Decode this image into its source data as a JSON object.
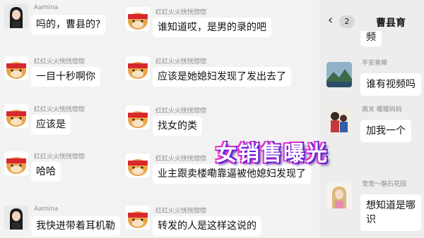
{
  "left_column": {
    "messages": [
      {
        "sender": "Aamina",
        "text": "吗的，曹县的?",
        "avatar": "woman-portrait-avatar"
      },
      {
        "sender": "红红火火恍恍惚惚",
        "text": "一目十秒啊你",
        "avatar": "bear-headband-avatar"
      },
      {
        "sender": "红红火火恍恍惚惚",
        "text": "应该是",
        "avatar": "bear-headband-avatar"
      },
      {
        "sender": "红红火火恍恍惚惚",
        "text": "哈哈",
        "avatar": "bear-headband-avatar"
      },
      {
        "sender": "Aamina",
        "text": "我快进带着耳机勒",
        "avatar": "woman-portrait-avatar"
      }
    ]
  },
  "middle_column": {
    "messages": [
      {
        "sender": "红红火火恍恍惚惚",
        "text": "谁知道哎，是男的录的吧"
      },
      {
        "sender": "红红火火恍恍惚惚",
        "text": "应该是她媳妇发现了发出去了"
      },
      {
        "sender": "红红火火恍恍惚惚",
        "text": "找女的类"
      },
      {
        "sender": "红红火火恍恍惚惚",
        "text": "业主跟卖楼嘞靠逼被他媳妇发现了"
      },
      {
        "sender": "红红火火恍恍惚惚",
        "text": "转发的人是这样这说的"
      }
    ]
  },
  "right_panel": {
    "header": {
      "back_icon": "‹",
      "unread_count": "2",
      "title": "曹县育"
    },
    "top_fragment": "频",
    "messages": [
      {
        "sender": "平安喜樂",
        "text": "谁有视频吗",
        "avatar": "landscape-avatar"
      },
      {
        "sender": "南关 暖暖妈妈",
        "text": "加我一个",
        "avatar": "mother-child-avatar"
      },
      {
        "sender": "宠宠～磐石花园",
        "text_line1": "想知道是哪",
        "text_line2": "识",
        "avatar": "woman-blonde-avatar"
      }
    ]
  },
  "overlay": {
    "text": "女销售曝光",
    "colors": {
      "fill": "#ffffff",
      "outline": "#6a1fd6",
      "glow": "#ff34c8"
    }
  }
}
